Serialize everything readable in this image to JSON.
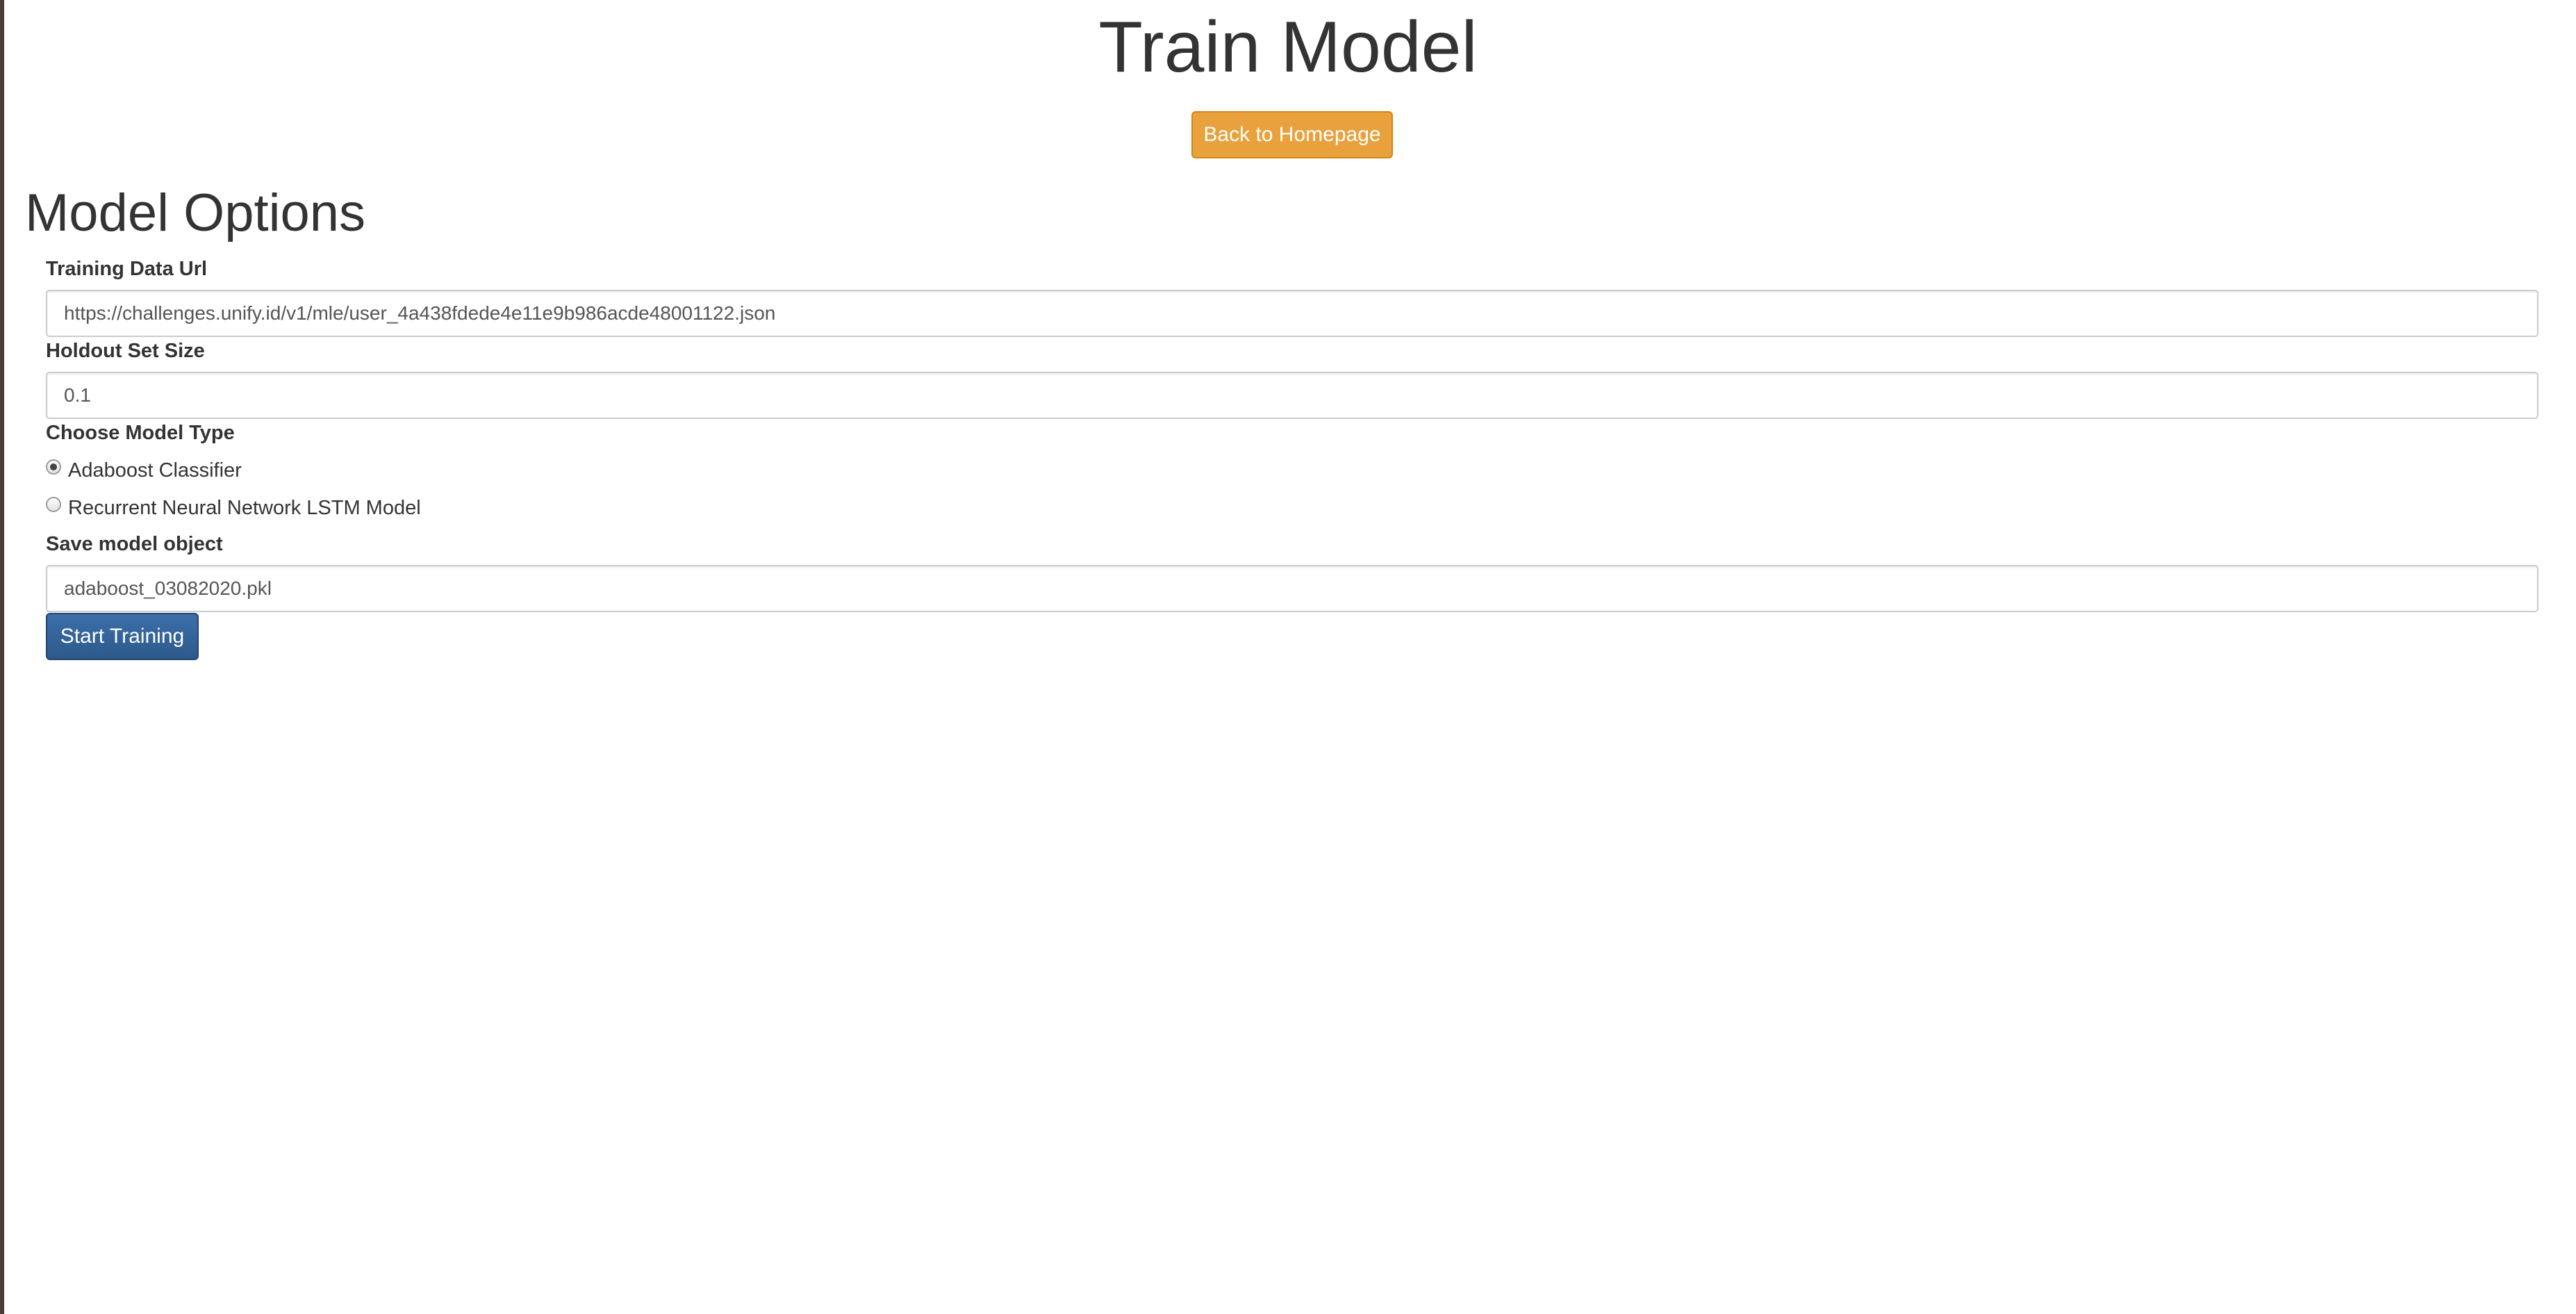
{
  "header": {
    "title": "Train Model",
    "back_button_label": "Back to Homepage"
  },
  "form": {
    "section_title": "Model Options",
    "training_data_url": {
      "label": "Training Data Url",
      "value": "https://challenges.unify.id/v1/mle/user_4a438fdede4e11e9b986acde48001122.json"
    },
    "holdout_set_size": {
      "label": "Holdout Set Size",
      "value": "0.1"
    },
    "model_type": {
      "label": "Choose Model Type",
      "options": [
        {
          "label": "Adaboost Classifier",
          "checked": true
        },
        {
          "label": "Recurrent Neural Network LSTM Model",
          "checked": false
        }
      ]
    },
    "save_model": {
      "label": "Save model object",
      "value": "adaboost_03082020.pkl"
    },
    "submit_label": "Start Training"
  },
  "colors": {
    "back_button": "#e8a13c",
    "start_button": "#336699",
    "text": "#333333"
  }
}
